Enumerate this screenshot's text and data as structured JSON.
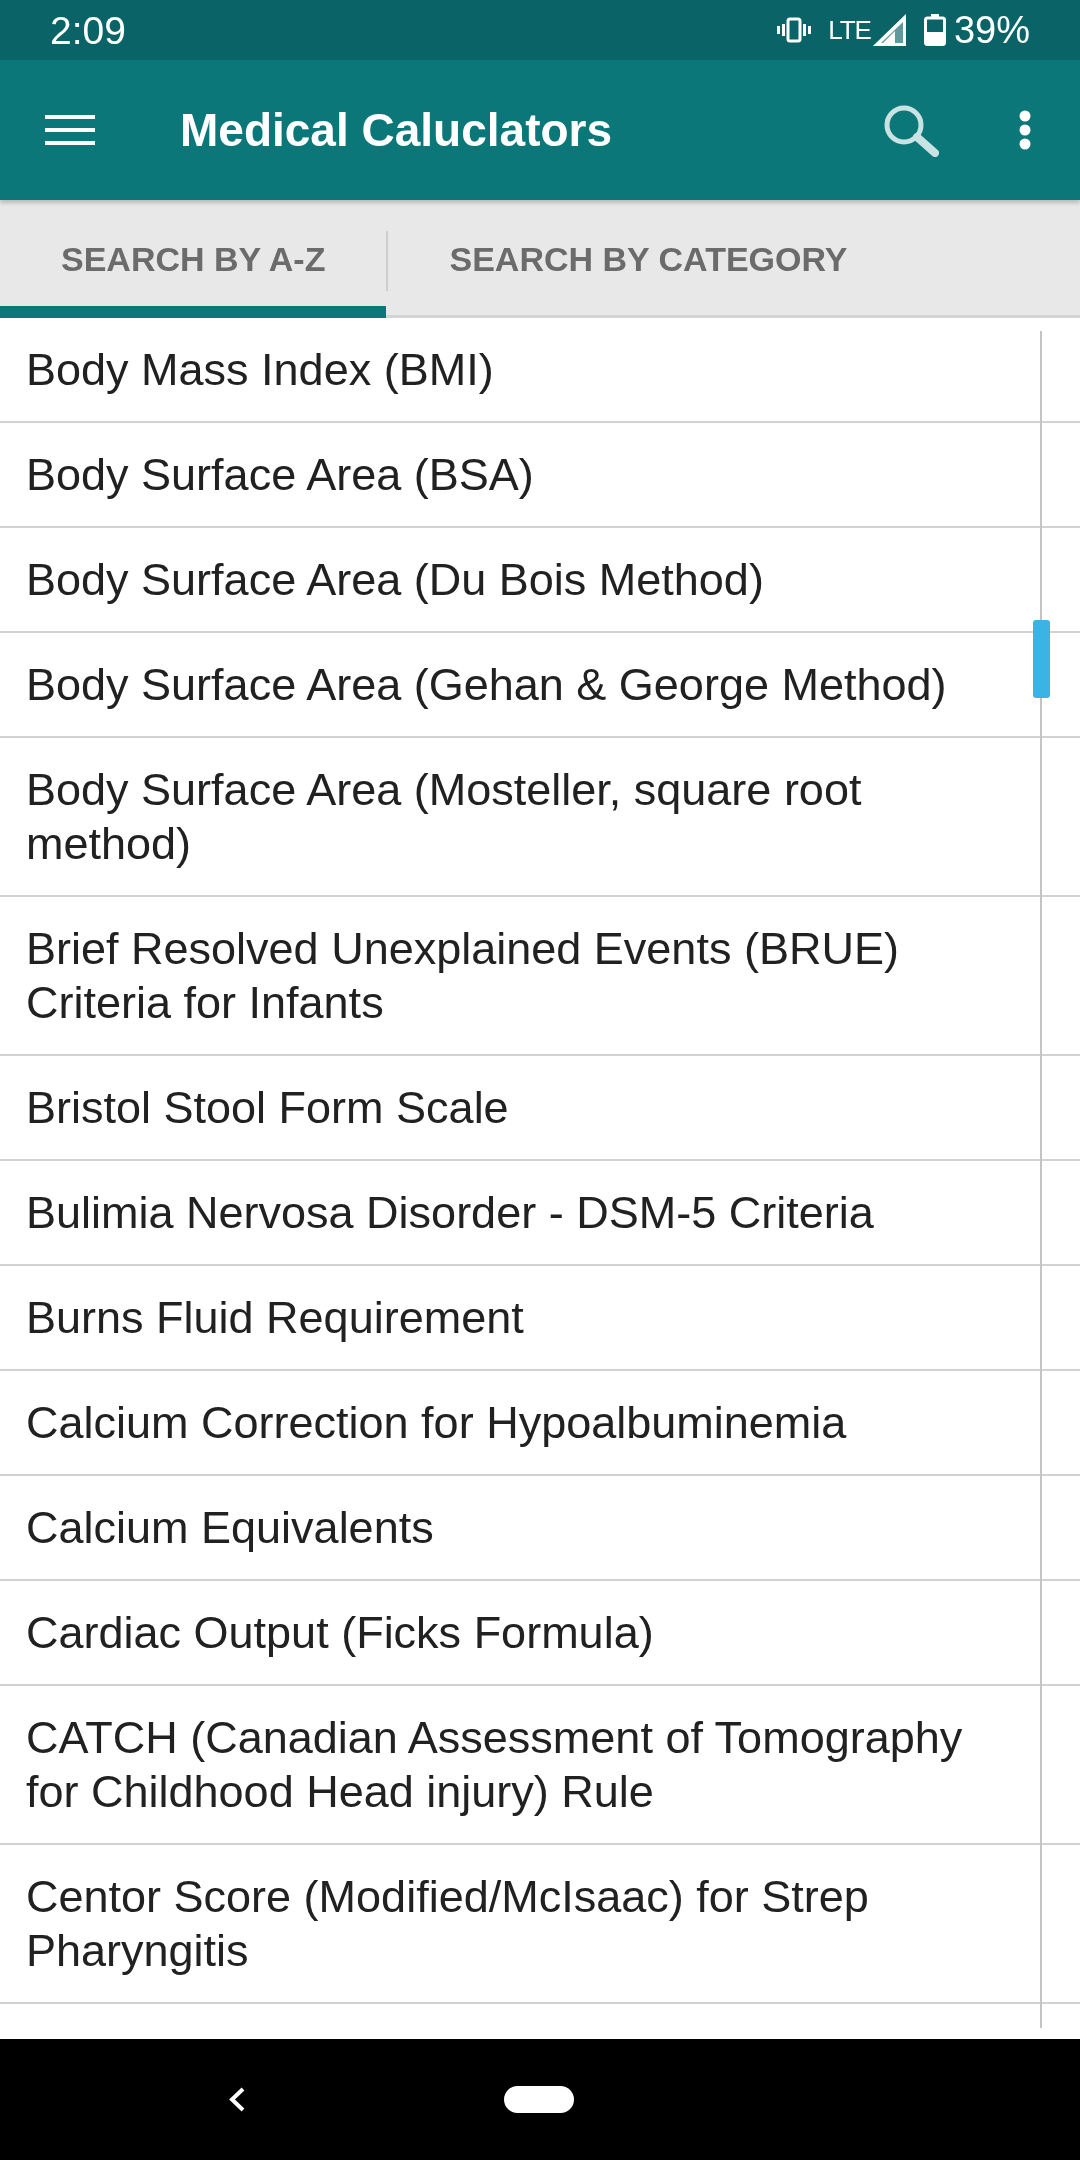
{
  "status_bar": {
    "time": "2:09",
    "network": "LTE",
    "battery": "39%"
  },
  "app_bar": {
    "title": "Medical Caluclators"
  },
  "tabs": [
    {
      "label": "SEARCH BY A-Z",
      "selected": true
    },
    {
      "label": "SEARCH BY CATEGORY",
      "selected": false
    }
  ],
  "calculators": [
    "Body Mass Index (BMI)",
    "Body Surface Area (BSA)",
    "Body Surface Area (Du Bois Method)",
    "Body Surface Area (Gehan & George Method)",
    "Body Surface Area (Mosteller, square root method)",
    "Brief Resolved Unexplained Events (BRUE) Criteria for Infants",
    "Bristol Stool Form Scale",
    "Bulimia Nervosa Disorder - DSM-5 Criteria",
    "Burns Fluid Requirement",
    "Calcium Correction for Hypoalbuminemia",
    "Calcium Equivalents",
    "Cardiac Output (Ficks Formula)",
    "CATCH (Canadian Assessment of Tomography for Childhood Head injury) Rule",
    "Centor Score (Modified/McIsaac) for Strep Pharyngitis"
  ]
}
